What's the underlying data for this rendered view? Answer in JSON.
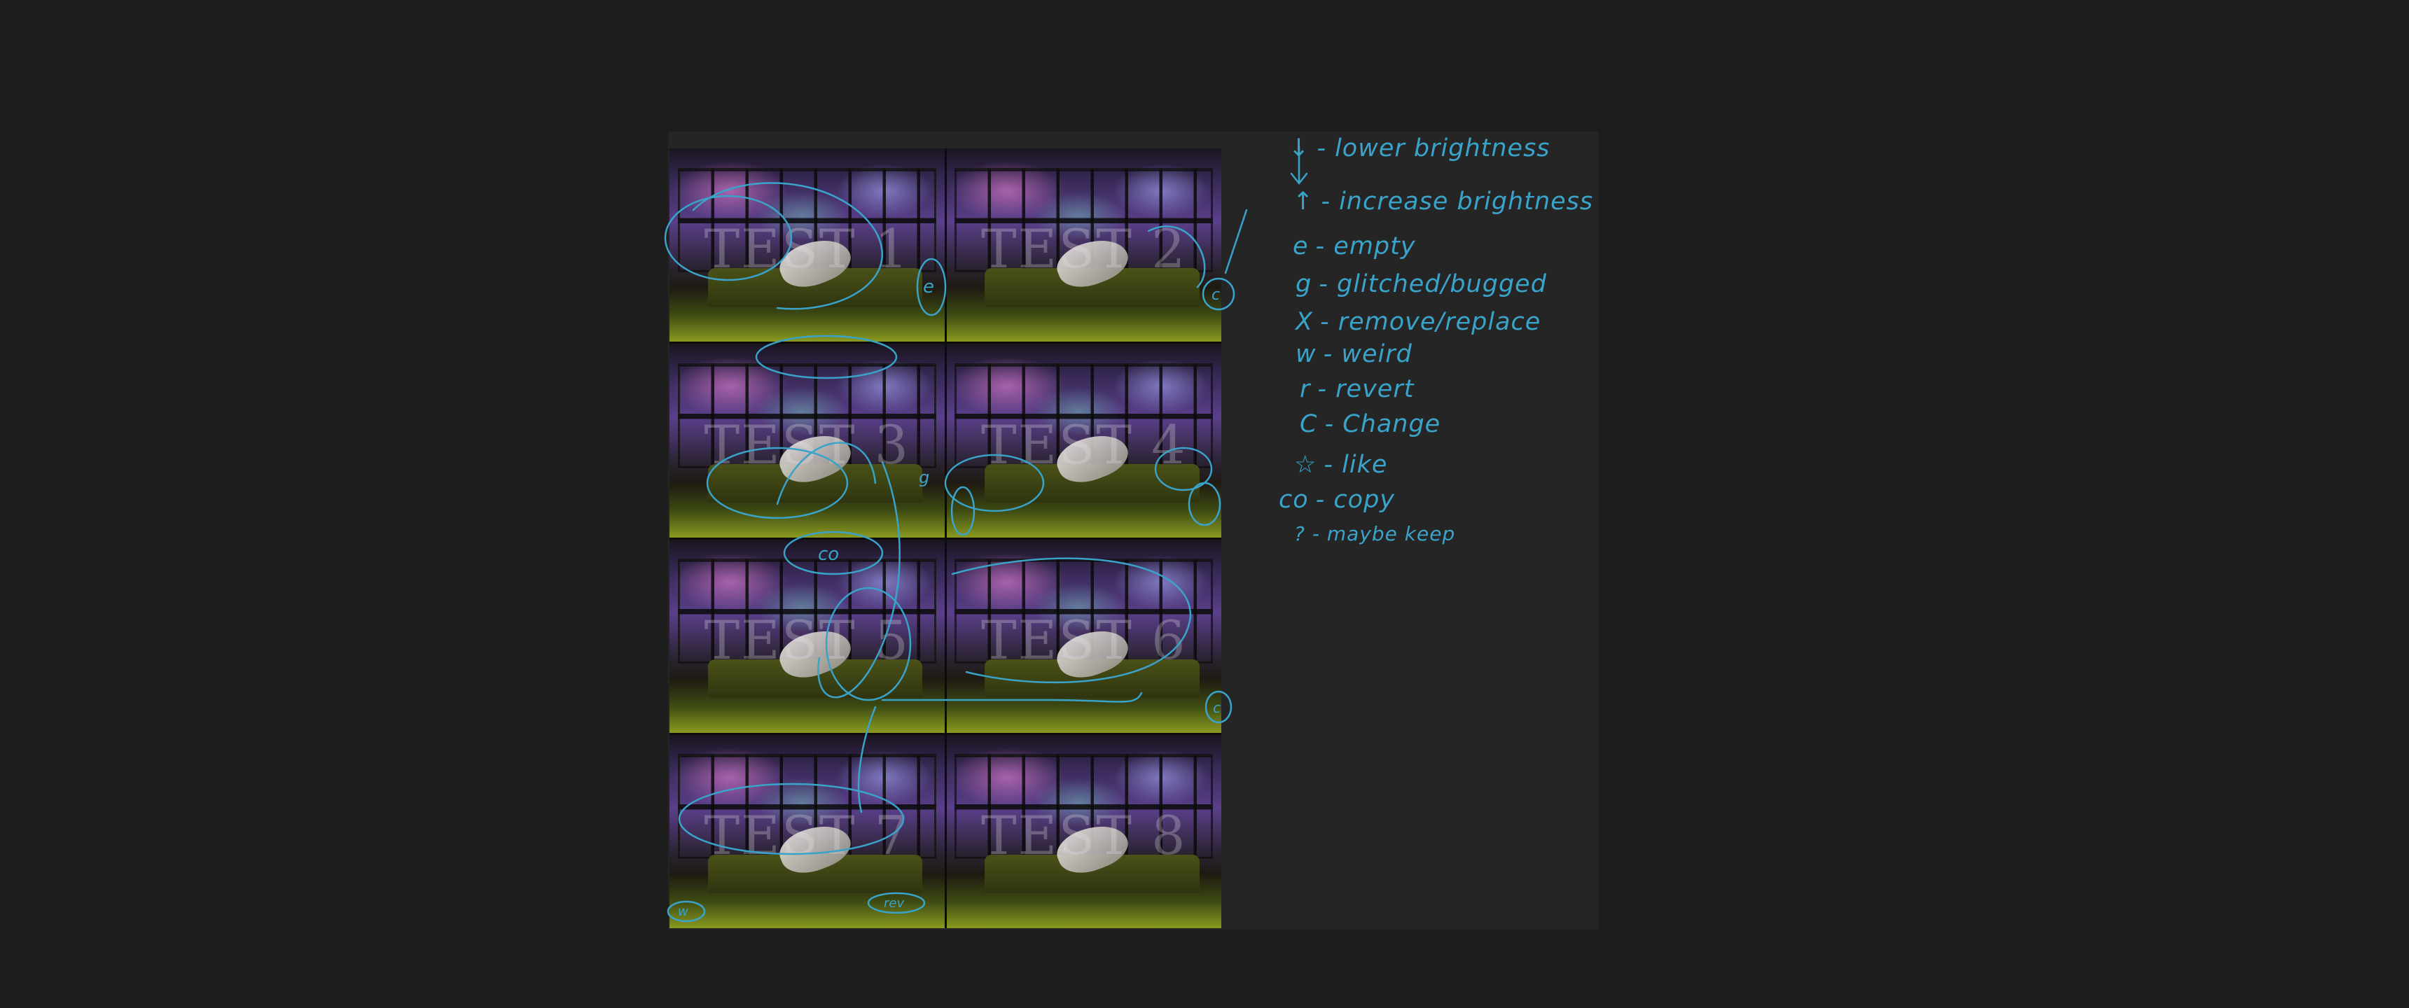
{
  "thumbnails": [
    {
      "label": "TEST 1"
    },
    {
      "label": "TEST 2"
    },
    {
      "label": "TEST 3"
    },
    {
      "label": "TEST 4"
    },
    {
      "label": "TEST 5"
    },
    {
      "label": "TEST 6"
    },
    {
      "label": "TEST 7"
    },
    {
      "label": "TEST 8"
    }
  ],
  "legend": [
    {
      "key": "↓",
      "text": "- lower brightness"
    },
    {
      "key": "↑",
      "text": "- increase brightness"
    },
    {
      "key": "e",
      "text": "- empty"
    },
    {
      "key": "g",
      "text": "- glitched/bugged"
    },
    {
      "key": "X",
      "text": "- remove/replace"
    },
    {
      "key": "w",
      "text": "- weird"
    },
    {
      "key": "r",
      "text": "- revert"
    },
    {
      "key": "C",
      "text": "- Change"
    },
    {
      "key": "☆",
      "text": "- like"
    },
    {
      "key": "co",
      "text": "- copy"
    },
    {
      "key": "?",
      "text": "- maybe keep"
    }
  ],
  "annotations": {
    "marks": [
      "e",
      "c",
      "g",
      "co",
      "rev",
      "w",
      "c"
    ]
  },
  "colors": {
    "ink": "#3aa3c9",
    "background": "#1d1d1d",
    "board": "#252525"
  }
}
